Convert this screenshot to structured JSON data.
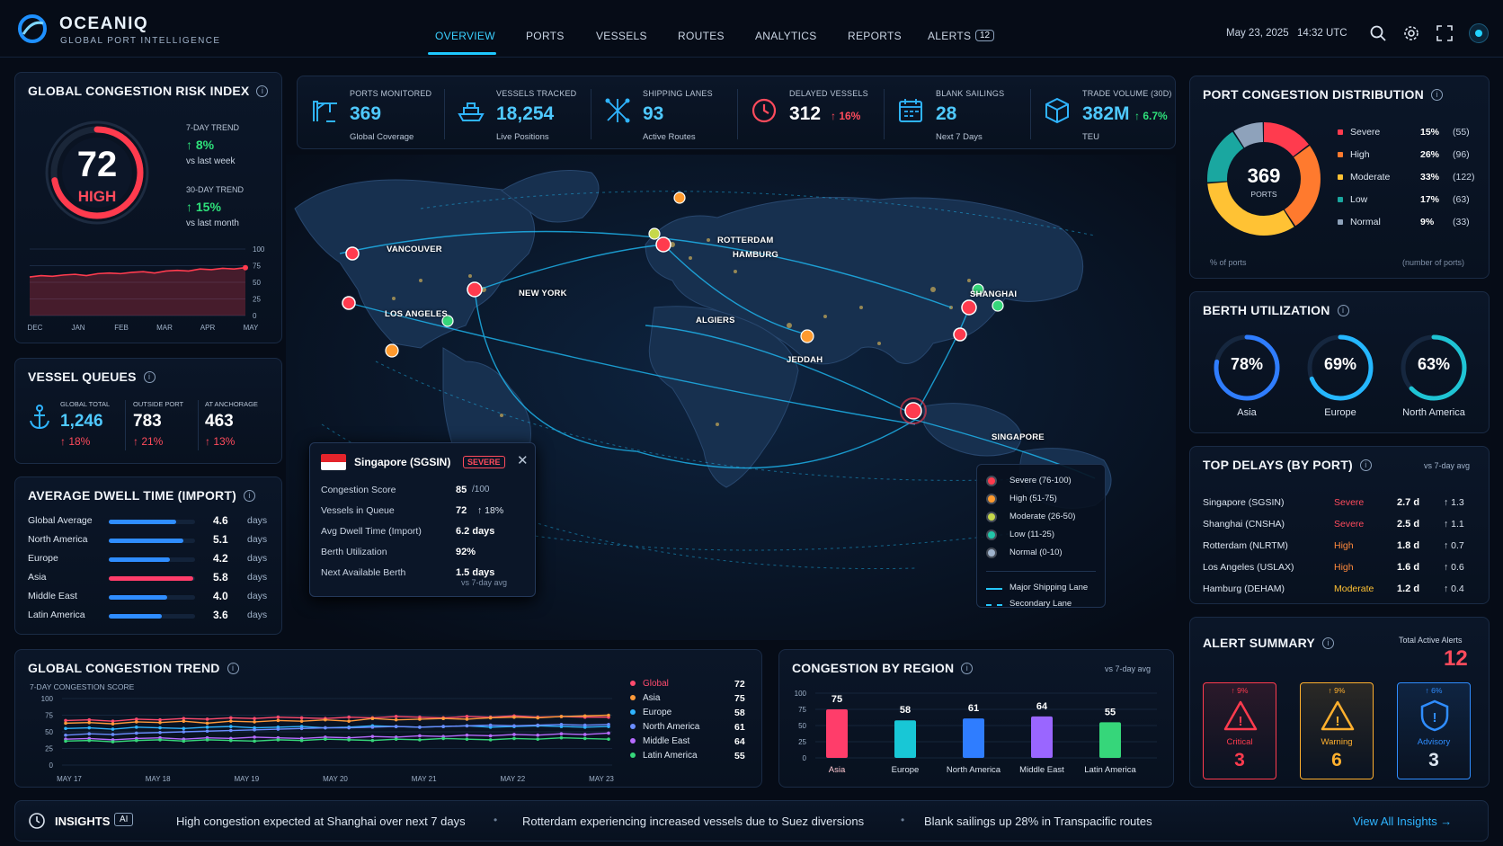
{
  "brand": {
    "name": "OCEANIQ",
    "tagline": "GLOBAL PORT INTELLIGENCE"
  },
  "nav": {
    "items": [
      "OVERVIEW",
      "PORTS",
      "VESSELS",
      "ROUTES",
      "ANALYTICS",
      "REPORTS",
      "ALERTS"
    ],
    "alerts_badge": "12"
  },
  "header": {
    "date": "May 23, 2025",
    "time": "14:32 UTC"
  },
  "risk": {
    "title": "GLOBAL CONGESTION RISK INDEX",
    "score": "72",
    "level": "HIGH",
    "trend7_label": "7-DAY TREND",
    "trend7_value": "↑ 8%",
    "trend7_sub": "vs last week",
    "trend30_label": "30-DAY TREND",
    "trend30_value": "↑ 15%",
    "trend30_sub": "vs last month",
    "gauge_fraction": 0.72,
    "chart": {
      "months": [
        "DEC",
        "JAN",
        "FEB",
        "MAR",
        "APR",
        "MAY"
      ],
      "yticks": [
        "100",
        "75",
        "50",
        "25",
        "0"
      ],
      "values": [
        58,
        60,
        59,
        61,
        62,
        60,
        63,
        64,
        63,
        65,
        66,
        64,
        67,
        68,
        67,
        70,
        69,
        71,
        70,
        72
      ]
    }
  },
  "kpis": [
    {
      "label": "PORTS MONITORED",
      "value": "369",
      "sub": "Global Coverage",
      "icon": "crane-icon"
    },
    {
      "label": "VESSELS TRACKED",
      "value": "18,254",
      "sub": "Live Positions",
      "icon": "ship-icon"
    },
    {
      "label": "SHIPPING LANES",
      "value": "93",
      "sub": "Active Routes",
      "icon": "routes-icon"
    },
    {
      "label": "DELAYED VESSELS",
      "value": "312",
      "change": "↑ 16%",
      "icon": "clock-icon"
    },
    {
      "label": "BLANK SAILINGS",
      "value": "28",
      "sub": "Next 7 Days",
      "icon": "calendar-icon"
    },
    {
      "label": "TRADE VOLUME (30D)",
      "value": "382M",
      "change": "↑ 6.7%",
      "sub": "TEU",
      "icon": "cube-icon"
    }
  ],
  "queues": {
    "title": "VESSEL QUEUES",
    "items": [
      {
        "label": "GLOBAL TOTAL",
        "value": "1,246",
        "change": "↑ 18%"
      },
      {
        "label": "OUTSIDE PORT",
        "value": "783",
        "change": "↑ 21%"
      },
      {
        "label": "AT ANCHORAGE",
        "value": "463",
        "change": "↑ 13%"
      }
    ]
  },
  "dwell": {
    "title": "AVERAGE DWELL TIME (IMPORT)",
    "unit": "days",
    "rows": [
      {
        "label": "Global Average",
        "value": "4.6",
        "fraction": 0.78,
        "color": "#2f8dff"
      },
      {
        "label": "North America",
        "value": "5.1",
        "fraction": 0.86,
        "color": "#2f8dff"
      },
      {
        "label": "Europe",
        "value": "4.2",
        "fraction": 0.71,
        "color": "#2f8dff"
      },
      {
        "label": "Asia",
        "value": "5.8",
        "fraction": 0.98,
        "color": "#ff3d6a"
      },
      {
        "label": "Middle East",
        "value": "4.0",
        "fraction": 0.68,
        "color": "#2f8dff"
      },
      {
        "label": "Latin America",
        "value": "3.6",
        "fraction": 0.61,
        "color": "#2f8dff"
      }
    ]
  },
  "map": {
    "labels": [
      "VANCOUVER",
      "LOS ANGELES",
      "NEW YORK",
      "ROTTERDAM",
      "HAMBURG",
      "ALGIERS",
      "JEDDAH",
      "SHANGHAI",
      "SINGAPORE"
    ],
    "legend": [
      {
        "label": "Severe (76-100)",
        "color": "#ff3b4e"
      },
      {
        "label": "High (51-75)",
        "color": "#ff9a2e"
      },
      {
        "label": "Moderate (26-50)",
        "color": "#c6d84a"
      },
      {
        "label": "Low (11-25)",
        "color": "#22c6a8"
      },
      {
        "label": "Normal (0-10)",
        "color": "#9fb3cc"
      }
    ],
    "lane_major": "Major Shipping Lane",
    "lane_secondary": "Secondary Lane"
  },
  "popup": {
    "port": "Singapore (SGSIN)",
    "badge": "SEVERE",
    "rows": [
      {
        "label": "Congestion Score",
        "value": "85",
        "suffix": "/100"
      },
      {
        "label": "Vessels in Queue",
        "value": "72",
        "change": "↑ 18%"
      },
      {
        "label": "Avg Dwell Time (Import)",
        "value": "6.2 days"
      },
      {
        "label": "Berth Utilization",
        "value": "92%"
      },
      {
        "label": "Next Available Berth",
        "value": "1.5 days"
      }
    ],
    "footer": "vs 7-day avg"
  },
  "distribution": {
    "title": "PORT CONGESTION DISTRIBUTION",
    "total": "369",
    "total_label": "PORTS",
    "footer_left": "% of ports",
    "footer_right": "(number of ports)",
    "rows": [
      {
        "label": "Severe",
        "pct": "15%",
        "count": "(55)",
        "color": "#ff3b4e",
        "value": 15
      },
      {
        "label": "High",
        "pct": "26%",
        "count": "(96)",
        "color": "#ff7a2e",
        "value": 26
      },
      {
        "label": "Moderate",
        "pct": "33%",
        "count": "(122)",
        "color": "#ffc234",
        "value": 33
      },
      {
        "label": "Low",
        "pct": "17%",
        "count": "(63)",
        "color": "#1aa7a0",
        "value": 17
      },
      {
        "label": "Normal",
        "pct": "9%",
        "count": "(33)",
        "color": "#8ea2bb",
        "value": 9
      }
    ]
  },
  "berth": {
    "title": "BERTH UTILIZATION",
    "items": [
      {
        "label": "Asia",
        "value": "78%",
        "fraction": 0.78,
        "color": "#2f7dff"
      },
      {
        "label": "Europe",
        "value": "69%",
        "fraction": 0.69,
        "color": "#25b7ff"
      },
      {
        "label": "North America",
        "value": "63%",
        "fraction": 0.63,
        "color": "#1fc4d4"
      }
    ]
  },
  "delays": {
    "title": "TOP DELAYS (BY PORT)",
    "note": "vs 7-day avg",
    "rows": [
      {
        "port": "Singapore (SGSIN)",
        "level": "Severe",
        "days": "2.7 d",
        "change": "↑ 1.3",
        "color": "#ff4b5c"
      },
      {
        "port": "Shanghai (CNSHA)",
        "level": "Severe",
        "days": "2.5 d",
        "change": "↑ 1.1",
        "color": "#ff4b5c"
      },
      {
        "port": "Rotterdam (NLRTM)",
        "level": "High",
        "days": "1.8 d",
        "change": "↑ 0.7",
        "color": "#ff8a3d"
      },
      {
        "port": "Los Angeles (USLAX)",
        "level": "High",
        "days": "1.6 d",
        "change": "↑ 0.6",
        "color": "#ff8a3d"
      },
      {
        "port": "Hamburg (DEHAM)",
        "level": "Moderate",
        "days": "1.2 d",
        "change": "↑ 0.4",
        "color": "#ffc234"
      }
    ]
  },
  "alerts": {
    "title": "ALERT SUMMARY",
    "total_label": "Total Active Alerts",
    "total": "12",
    "cards": [
      {
        "label": "Critical",
        "count": "3",
        "change": "↑ 9%",
        "color": "#ff3b4e"
      },
      {
        "label": "Warning",
        "count": "6",
        "change": "↑ 9%",
        "color": "#ffb02e"
      },
      {
        "label": "Advisory",
        "count": "3",
        "change": "↑ 6%",
        "color": "#2f8dff"
      }
    ]
  },
  "trend": {
    "title": "GLOBAL CONGESTION TREND",
    "subtitle": "7-DAY CONGESTION SCORE"
  },
  "region": {
    "title": "CONGESTION BY REGION",
    "note": "vs 7-day avg"
  },
  "chart_data": [
    {
      "type": "line",
      "title": "GLOBAL CONGESTION TREND",
      "ylabel": "7-DAY CONGESTION SCORE",
      "ylim": [
        0,
        100
      ],
      "yticks": [
        "100",
        "75",
        "50",
        "25",
        "0"
      ],
      "x": [
        "MAY 17",
        "MAY 18",
        "MAY 19",
        "MAY 20",
        "MAY 21",
        "MAY 22",
        "MAY 23"
      ],
      "series": [
        {
          "name": "Global",
          "last": "72",
          "color": "#ff4b6e",
          "values": [
            67,
            68,
            66,
            69,
            68,
            70,
            69,
            71,
            70,
            72,
            71,
            70,
            72,
            71,
            73,
            72,
            71,
            73,
            72,
            74,
            72,
            73,
            72,
            72
          ]
        },
        {
          "name": "Asia",
          "last": "75",
          "color": "#ff9a3a",
          "values": [
            63,
            64,
            62,
            65,
            64,
            66,
            63,
            66,
            65,
            67,
            66,
            68,
            66,
            70,
            68,
            69,
            70,
            69,
            71,
            72,
            71,
            73,
            74,
            75
          ]
        },
        {
          "name": "Europe",
          "last": "58",
          "color": "#2fb4ff",
          "values": [
            55,
            56,
            54,
            57,
            56,
            55,
            57,
            58,
            56,
            57,
            58,
            56,
            57,
            59,
            58,
            57,
            58,
            59,
            57,
            58,
            59,
            58,
            57,
            58
          ]
        },
        {
          "name": "North America",
          "last": "61",
          "color": "#6a8dff",
          "values": [
            45,
            47,
            46,
            48,
            49,
            50,
            51,
            52,
            53,
            54,
            55,
            56,
            56,
            57,
            58,
            57,
            58,
            59,
            60,
            59,
            60,
            61,
            60,
            61
          ]
        },
        {
          "name": "Middle East",
          "last": "64",
          "color": "#b76bff",
          "values": [
            39,
            40,
            38,
            40,
            41,
            39,
            41,
            40,
            42,
            41,
            40,
            42,
            41,
            43,
            42,
            44,
            43,
            45,
            44,
            46,
            45,
            47,
            46,
            48
          ]
        },
        {
          "name": "Latin America",
          "last": "55",
          "color": "#36d67a",
          "values": [
            36,
            37,
            35,
            37,
            38,
            36,
            38,
            37,
            36,
            38,
            37,
            39,
            38,
            37,
            39,
            38,
            40,
            39,
            38,
            40,
            39,
            41,
            40,
            39
          ]
        }
      ]
    },
    {
      "type": "bar",
      "title": "CONGESTION BY REGION",
      "ylim": [
        0,
        100
      ],
      "yticks": [
        "100",
        "75",
        "50",
        "25",
        "0"
      ],
      "categories": [
        "Asia",
        "Europe",
        "North America",
        "Middle East",
        "Latin America"
      ],
      "values": [
        75,
        58,
        61,
        64,
        55
      ],
      "colors": [
        "#ff3d6a",
        "#18c7d6",
        "#2f7dff",
        "#9a66ff",
        "#36d67a"
      ]
    }
  ],
  "insights": {
    "label": "INSIGHTS",
    "ai": "AI",
    "items": [
      "High congestion expected at Shanghai over next 7 days",
      "Rotterdam experiencing increased vessels due to Suez diversions",
      "Blank sailings up 28% in Transpacific routes"
    ],
    "link": "View All Insights →"
  }
}
